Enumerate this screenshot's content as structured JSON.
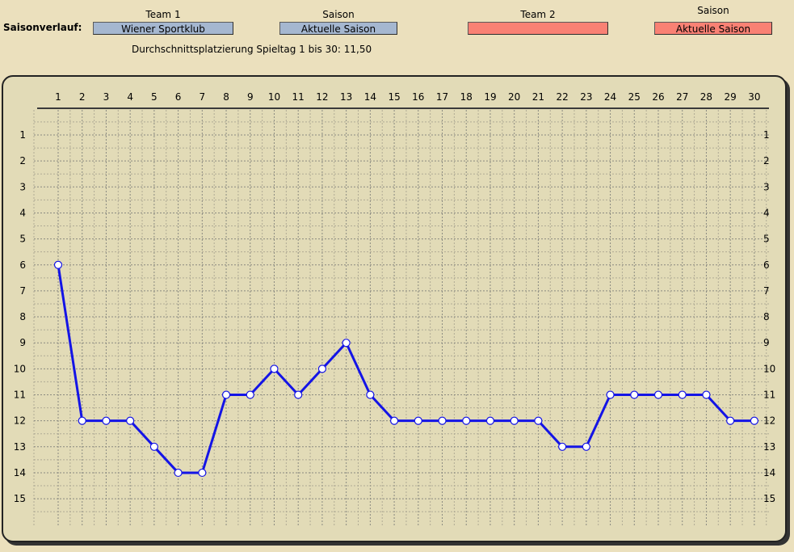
{
  "header": {
    "title": "Saisonverlauf:",
    "team1_label": "Team 1",
    "season1_label": "Saison",
    "team2_label": "Team 2",
    "season2_label": "Saison",
    "team1_value": "Wiener Sportklub",
    "season1_value": "Aktuelle Saison",
    "team2_value": "",
    "season2_value": "Aktuelle Saison",
    "average_text": "Durchschnittsplatzierung Spieltag 1 bis 30: 11,50"
  },
  "colors": {
    "team1_select": "#a5b7d0",
    "team2_select": "#f98174",
    "line": "#1414e6",
    "marker_fill": "#ffffff"
  },
  "chart_data": {
    "type": "line",
    "title": "",
    "xlabel": "",
    "ylabel": "",
    "x": [
      1,
      2,
      3,
      4,
      5,
      6,
      7,
      8,
      9,
      10,
      11,
      12,
      13,
      14,
      15,
      16,
      17,
      18,
      19,
      20,
      21,
      22,
      23,
      24,
      25,
      26,
      27,
      28,
      29,
      30
    ],
    "series": [
      {
        "values": [
          6,
          12,
          12,
          12,
          13,
          14,
          14,
          11,
          11,
          10,
          11,
          10,
          9,
          11,
          12,
          12,
          12,
          12,
          12,
          12,
          12,
          13,
          13,
          11,
          11,
          11,
          11,
          11,
          12,
          12
        ]
      }
    ],
    "y_ticks": [
      1,
      2,
      3,
      4,
      5,
      6,
      7,
      8,
      9,
      10,
      11,
      12,
      13,
      14,
      15
    ],
    "ylim": [
      0,
      16
    ],
    "y_inverted": true,
    "x_axis_position": "top",
    "y_labels_both_sides": true,
    "grid": true
  }
}
